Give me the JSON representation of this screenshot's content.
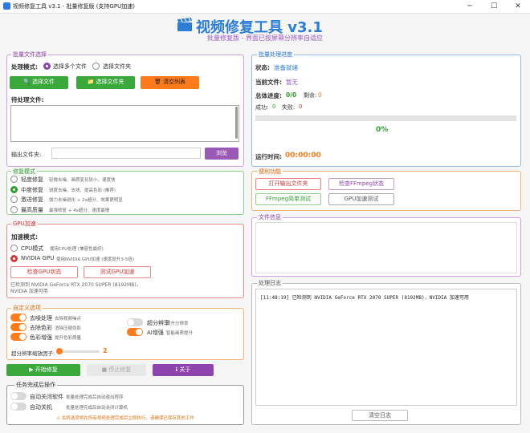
{
  "window": {
    "title": "视频修复工具 v3.1 - 批量修复版 (支持GPU加速)",
    "minimize": "─",
    "maximize": "☐",
    "close": "✕"
  },
  "header": {
    "title": "视频修复工具 v3.1",
    "subtitle": "批量修复版 - 界面已按屏幕分辨率自适应"
  },
  "batch": {
    "title": "批量文件选择",
    "mode_label": "处理模式:",
    "mode_multi": "选择多个文件",
    "mode_folder": "选择文件夹",
    "btn_files": "选择文件",
    "btn_folder": "选择文件夹",
    "btn_clear": "清空列表",
    "pending_label": "待处理文件:",
    "output_label": "输出文件夹:",
    "output_value": "",
    "browse": "浏览"
  },
  "progress": {
    "title": "批量处理进度",
    "status_label": "状态:",
    "status_value": "准备就绪",
    "current_label": "当前文件:",
    "current_value": "暂无",
    "total_label": "总体进度:",
    "total_value": "0/0",
    "remain_label": "剩余:",
    "remain_value": "0",
    "success_label": "成功:",
    "success_value": "0",
    "fail_label": "失败:",
    "fail_value": "0",
    "percent": "0%",
    "percent_num": 0,
    "time_label": "运行时间:",
    "time_value": "00:00:00"
  },
  "repair": {
    "title": "修复模式",
    "options": [
      {
        "label": "轻度修复",
        "desc": "轻微去噪、画质变化较小，速度快"
      },
      {
        "label": "中度修复",
        "desc": "锐度去噪、去块、提高色彩 (推荐)"
      },
      {
        "label": "激进修复",
        "desc": "强力去噪锐化 + 2x超分、效果更明显"
      },
      {
        "label": "最高质量",
        "desc": "最强修复 + 4x超分、速度最慢"
      }
    ]
  },
  "tools": {
    "title": "便利功能",
    "open_output": "打开输出文件夹",
    "check_ffmpeg": "检查FFmpeg状态",
    "ffmpeg_test": "FFmpeg简单测试",
    "gpu_test": "GPU加速测试"
  },
  "gpu": {
    "title": "GPU加速",
    "accel_label": "加速模式:",
    "cpu_label": "CPU模式",
    "cpu_desc": "使用CPU处理 (兼容性最好)",
    "nv_label": "NVIDIA GPU",
    "nv_desc": "使用NVIDIA GPU加速 (速度提升3-5倍)",
    "check_btn": "检查GPU状态",
    "test_btn": "测试GPU加速",
    "detected": "已检测到 NVIDIA GeForce RTX 2070 SUPER (8192MB)，NVIDIA 加速可用"
  },
  "fileinfo": {
    "title": "文件信息"
  },
  "custom": {
    "title": "自定义选项",
    "items": [
      {
        "label": "去噪处理",
        "desc": "去除视频噪点",
        "on": true
      },
      {
        "label": "去除色彩",
        "desc": "消除压缩伪影",
        "on": true
      },
      {
        "label": "色彩增强",
        "desc": "提升色彩质量",
        "on": true
      }
    ],
    "items2": [
      {
        "label": "超分辨率",
        "desc": "提升分辨率",
        "on": false
      },
      {
        "label": "AI增强",
        "desc": "智能画质提升",
        "on": true
      }
    ],
    "scale_label": "超分辨率缩放因子:",
    "scale_value": "2"
  },
  "log": {
    "title": "处理日志",
    "line": "[11:48:19] 已检测到 NVIDIA GeForce RTX 2070 SUPER (8192MB)，NVIDIA 加速可用",
    "clear": "清空日志"
  },
  "actions": {
    "start": "开始修复",
    "stop": "停止修复",
    "about": "关于"
  },
  "after": {
    "title": "任务完成后操作",
    "items": [
      {
        "label": "自动关闭软件",
        "desc": "批量处理完成后自动退出程序"
      },
      {
        "label": "自动关机",
        "desc": "批量处理完成后自动关闭计算机"
      }
    ],
    "warn": "关机选项将在所有视频处理完成后立即执行，请确保已保存其他工作"
  },
  "colors": {
    "accent": "#2b7dd8",
    "green": "#3aa83a",
    "orange": "#ff7a1a",
    "purple": "#8e44ad",
    "red": "#d23a3a"
  }
}
